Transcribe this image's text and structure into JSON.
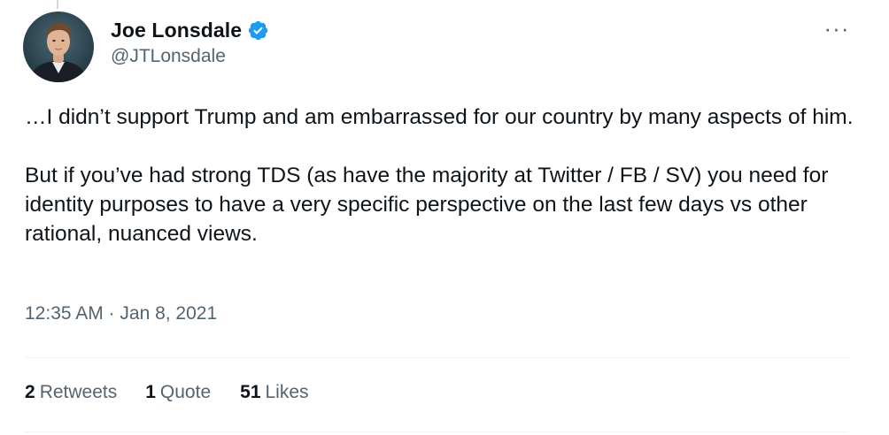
{
  "author": {
    "display_name": "Joe Lonsdale",
    "handle": "@JTLonsdale",
    "verified": true,
    "verified_color": "#1d9bf0"
  },
  "more_menu": {
    "label": "···"
  },
  "tweet": {
    "paragraphs": [
      "…I didn’t support Trump and am embarrassed for our country by many aspects of him.",
      "But if you’ve had strong TDS (as have the majority at Twitter / FB / SV) you need for identity purposes to have a very specific perspective on the last few days vs other rational, nuanced views."
    ],
    "timestamp": "12:35 AM · Jan 8, 2021"
  },
  "stats": {
    "retweets": {
      "count": "2",
      "label": "Retweets"
    },
    "quotes": {
      "count": "1",
      "label": "Quote"
    },
    "likes": {
      "count": "51",
      "label": "Likes"
    }
  }
}
